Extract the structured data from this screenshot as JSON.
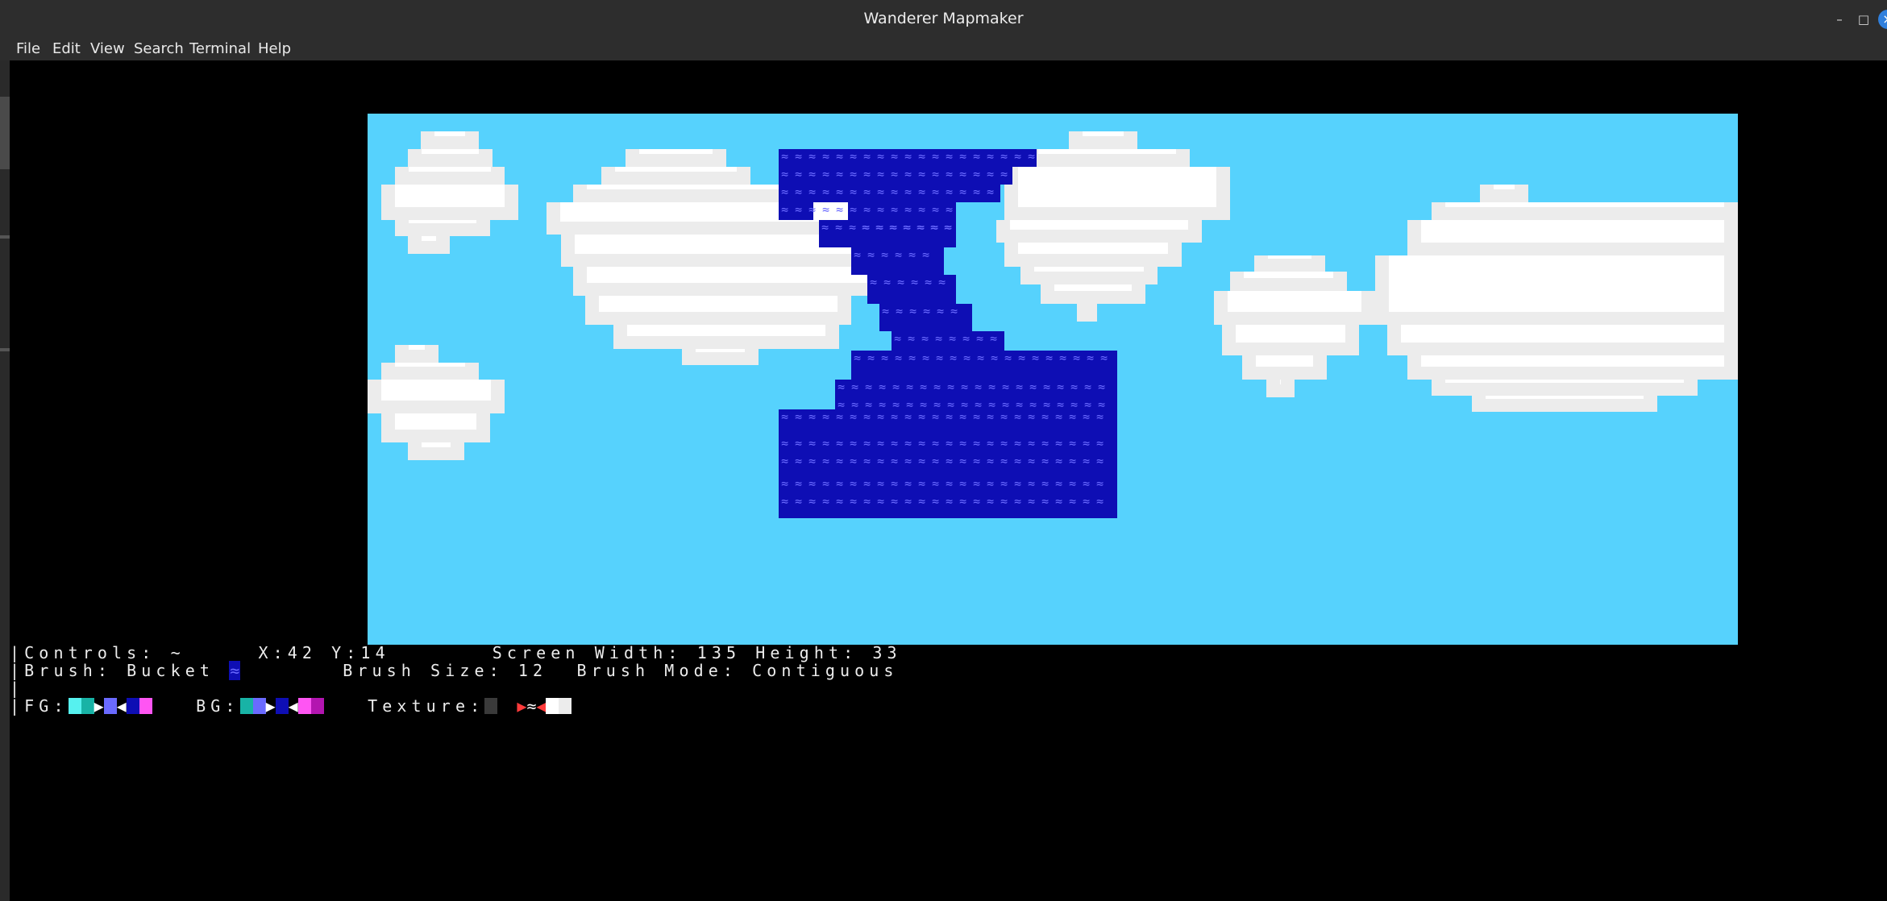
{
  "window": {
    "title": "Wanderer Mapmaker"
  },
  "menu": [
    "File",
    "Edit",
    "View",
    "Search",
    "Terminal",
    "Help"
  ],
  "map": {
    "sky_color": "#56d2fd",
    "cloud_color": "#ffffff",
    "cloud_shade": "#ececec",
    "water_color": "#0e0eb4",
    "water_glyph": "≈"
  },
  "status": {
    "line1_controls": "Controls: ~",
    "line1_coords": "X:42 Y:14",
    "line1_screen": "Screen Width: 135 Height: 33",
    "line2_brush": "Brush: Bucket",
    "line2_brush_glyph": "≈",
    "line2_size": "Brush Size: 12  Brush Mode: Contiguous",
    "line4_fg_label": "FG:",
    "line4_bg_label": "BG:",
    "line4_texture_label": "Texture:",
    "texture_glyph": "≈",
    "right_arrow": "▶",
    "left_arrow": "◀",
    "bar": "|",
    "fg_swatches": [
      "#56f1ef",
      "#18b3a6",
      "#6a6aff",
      "#0e0eb4",
      "#ff55f3"
    ],
    "bg_swatches": [
      "#18b3a6",
      "#6a6aff",
      "#0e0eb4",
      "#ff55f3",
      "#b315b0"
    ],
    "texture_swatches": [
      "#3a3a3a",
      "#ffffff",
      "#ececec"
    ]
  }
}
